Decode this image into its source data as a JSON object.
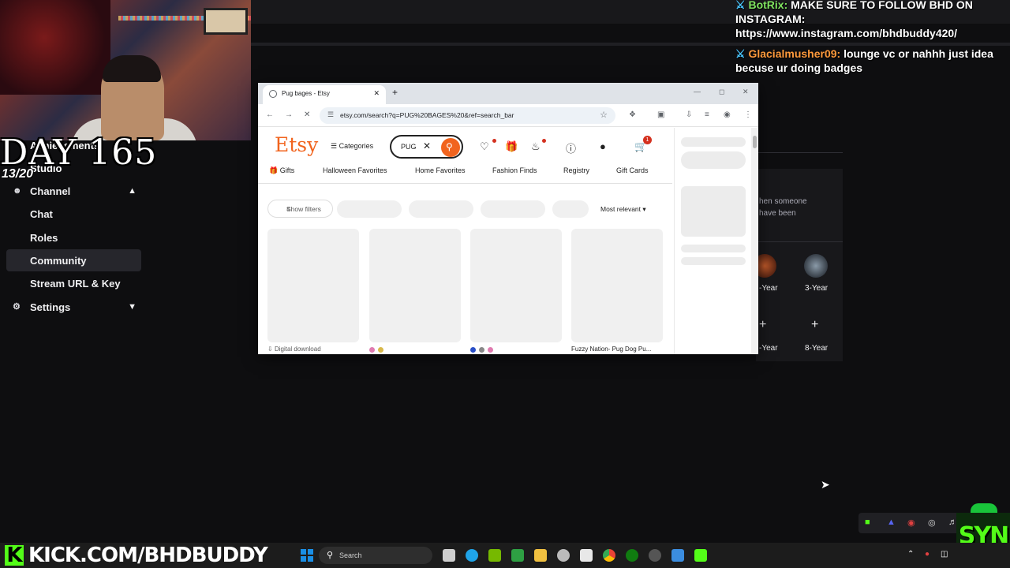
{
  "overlay": {
    "day": "DAY 165",
    "day_count": "13/20",
    "kick_url": "KICK.COM/BHDBUDDY",
    "kick_k": "K",
    "brand_corner": "SYN"
  },
  "chat": [
    {
      "user": "BotRix:",
      "text": "MAKE SURE TO FOLLOW BHD ON INSTAGRAM: https://www.instagram.com/bhdbuddy420/"
    },
    {
      "user": "Glacialmusher09:",
      "text": "lounge vc or nahhh just idea becuse ur doing badges"
    }
  ],
  "sidebar": {
    "achievements": "Achievements",
    "studio": "Studio",
    "channel": "Channel",
    "items": [
      "Chat",
      "Roles",
      "Community",
      "Stream URL & Key"
    ],
    "settings": "Settings"
  },
  "badges": {
    "desc_line1": "hen someone",
    "desc_line2": "have been",
    "labels": [
      "-Year",
      "3-Year",
      "-Year",
      "8-Year"
    ]
  },
  "browser": {
    "tab_title": "Pug bages - Etsy",
    "url": "etsy.com/search?q=PUG%20BAGES%20&ref=search_bar"
  },
  "etsy": {
    "logo": "Etsy",
    "categories": "Categories",
    "search_value": "PUG",
    "cart_count": "1",
    "nav": [
      "Gifts",
      "Halloween Favorites",
      "Home Favorites",
      "Fashion Finds",
      "Registry",
      "Gift Cards"
    ],
    "show_filters": "Show filters",
    "sort": "Most relevant",
    "card_footer_1": "Digital download",
    "card_footer_4": "Fuzzy Nation- Pug Dog Pu..."
  },
  "taskbar": {
    "search_placeholder": "Search"
  },
  "colors": {
    "etsy_orange": "#f1641e",
    "kick_green": "#53fc18",
    "chat_user_green": "#7fe35f",
    "chat_user_orange": "#ff9a3c"
  }
}
